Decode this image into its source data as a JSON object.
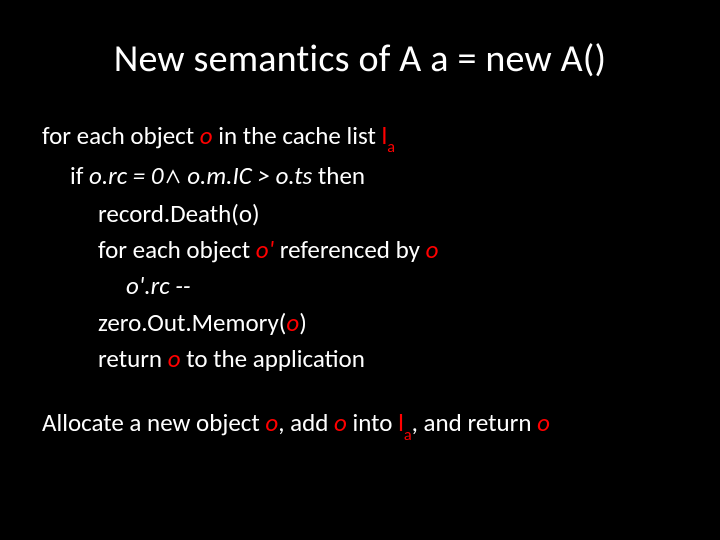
{
  "title": "New semantics of  A a = new A()",
  "code": {
    "l1a": "for each object ",
    "l1b": "o",
    "l1c": " in the cache list ",
    "l1d": "l",
    "l1e": "a",
    "l2a": "if ",
    "l2b": "o.rc = 0",
    "l2c": "   o.m.IC > o.ts",
    "l2d": "  then",
    "l3": " record.Death(o)",
    "l4a": "for each object ",
    "l4b": "o'",
    "l4c": " referenced by ",
    "l4d": "o",
    "l5": "o'.rc  --",
    "l6a": " zero.Out.Memory(",
    "l6b": "o",
    "l6c": ")",
    "l7a": "return ",
    "l7b": "o",
    "l7c": " to the application"
  },
  "footer": {
    "a": "Allocate a new object ",
    "b": "o",
    "c": ", add ",
    "d": "o",
    "e": " into ",
    "f": "l",
    "g": "a",
    "h": ", and  return ",
    "i": "o"
  }
}
